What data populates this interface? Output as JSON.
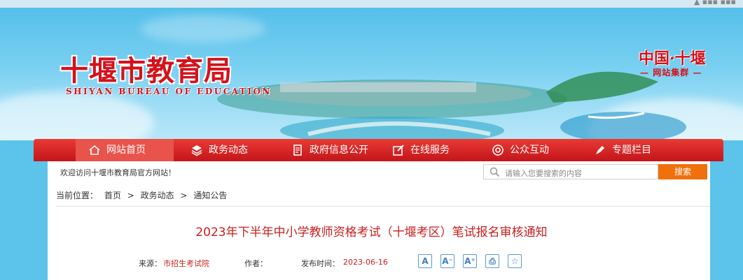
{
  "banner": {
    "title": "十堰市教育局",
    "subtitle": "SHIYAN BUREAU OF EDUCATION",
    "group_title": "中国·十堰",
    "group_subtitle": "网站集群"
  },
  "nav": {
    "items": [
      {
        "label": "网站首页",
        "icon": "home-icon"
      },
      {
        "label": "政务动态",
        "icon": "layers-icon"
      },
      {
        "label": "政府信息公开",
        "icon": "document-icon"
      },
      {
        "label": "在线服务",
        "icon": "edit-icon"
      },
      {
        "label": "公众互动",
        "icon": "chat-icon"
      },
      {
        "label": "专题栏目",
        "icon": "pen-icon"
      }
    ]
  },
  "welcome": "欢迎访问十堰市教育局官方网站！",
  "search": {
    "placeholder": "请输入您要搜索的内容",
    "button": "搜索"
  },
  "breadcrumb": {
    "prefix": "当前位置：",
    "items": [
      "首页",
      "政务动态",
      "通知公告"
    ],
    "sep": ">"
  },
  "article": {
    "title": "2023年下半年中小学教师资格考试（十堰考区）笔试报名审核通知",
    "source_label": "来源：",
    "source": "市招生考试院",
    "author_label": "作者：",
    "date_label": "发布时间：",
    "date": "2023-06-16",
    "tools": [
      {
        "label": "A",
        "icon": "font-default-icon"
      },
      {
        "label": "A⁻",
        "icon": "font-decrease-icon"
      },
      {
        "label": "A⁺",
        "icon": "font-increase-icon"
      },
      {
        "label": "⎙",
        "icon": "print-icon"
      },
      {
        "label": "☆",
        "icon": "favorite-icon"
      }
    ]
  },
  "colors": {
    "brand_red": "#d4121b",
    "search_orange": "#f0700c"
  }
}
